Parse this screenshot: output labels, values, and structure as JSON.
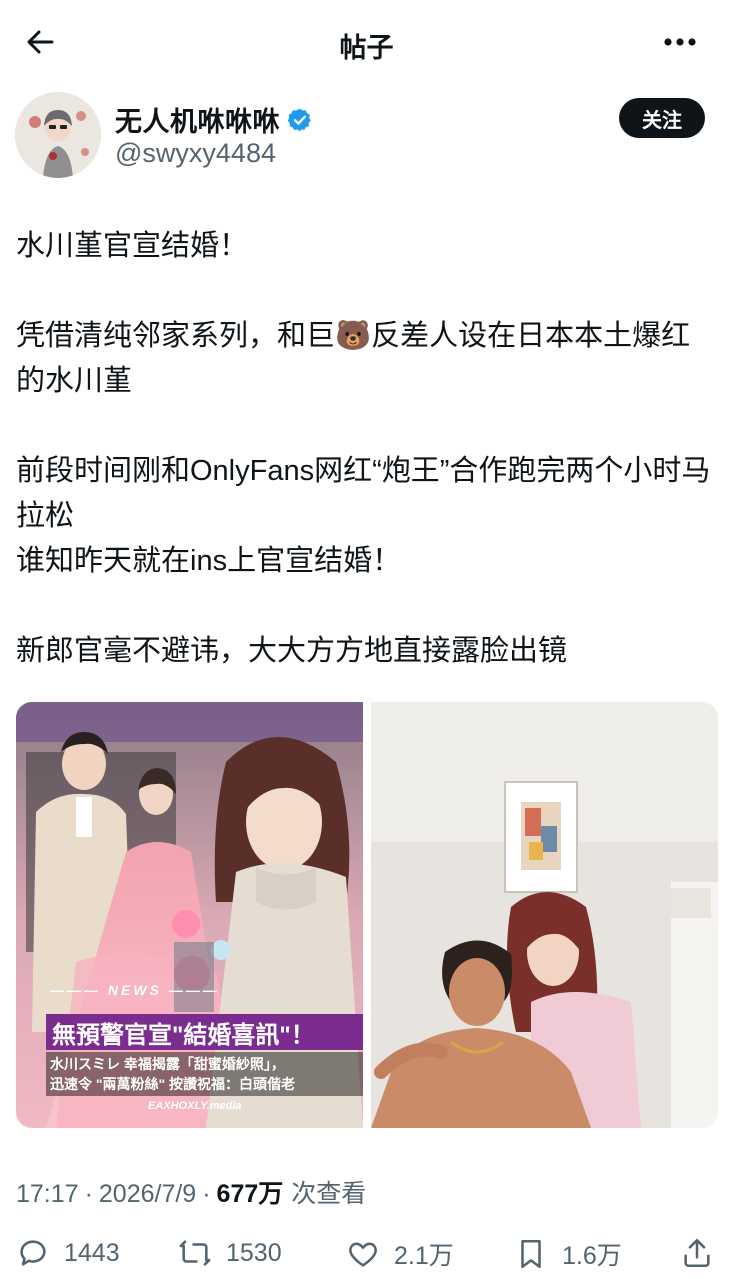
{
  "header": {
    "title": "帖子"
  },
  "author": {
    "display_name": "无人机咻咻咻",
    "handle": "@swyxy4484",
    "verified": true,
    "follow_label": "关注"
  },
  "post": {
    "paragraphs": [
      "水川堇官宣结婚！",
      "凭借清纯邻家系列，和巨🐻反差人设在日本本土爆红的水川堇",
      "前段时间刚和OnlyFans网红“炮王”合作跑完两个小时马拉松\n谁知昨天就在ins上官宣结婚！",
      "新郎官毫不避讳，大大方方地直接露脸出镜"
    ]
  },
  "media": {
    "image1": {
      "news_tag": "NEWS",
      "headline": "無預警官宣\"結婚喜訊\"！",
      "subline_1": "水川スミレ 幸福揭露「甜蜜婚紗照」，",
      "subline_2": "迅速令 \"兩萬粉絲\" 按讚祝福：白頭偕老",
      "watermark": "EAXHOXLY.media"
    }
  },
  "meta": {
    "time": "17:17",
    "separator": "·",
    "date": "2026/7/9",
    "views": "677万",
    "views_label": "次查看"
  },
  "actions": {
    "reply_count": "1443",
    "retweet_count": "1530",
    "like_count": "2.1万",
    "bookmark_count": "1.6万"
  },
  "colors": {
    "text_primary": "#0f1419",
    "text_secondary": "#536471",
    "verified_blue": "#1d9bf0",
    "headline_purple": "#7a2d8f"
  }
}
